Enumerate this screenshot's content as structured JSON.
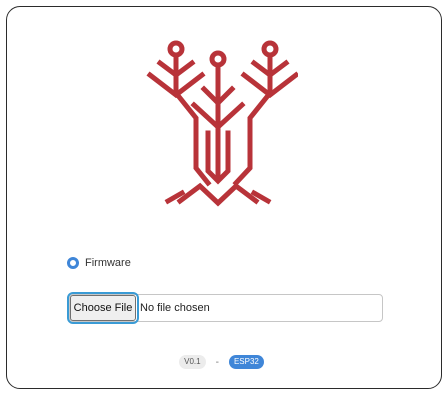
{
  "colors": {
    "logo": "#b83339",
    "accent": "#3f86d8"
  },
  "logo": {
    "icon": "tree-roots-logo-icon"
  },
  "firmware_option": {
    "label": "Firmware",
    "selected": true
  },
  "file_picker": {
    "button_label": "Choose File",
    "status_text": "No file chosen"
  },
  "footer": {
    "version": "V0.1",
    "separator": "-",
    "chip": "ESP32"
  }
}
